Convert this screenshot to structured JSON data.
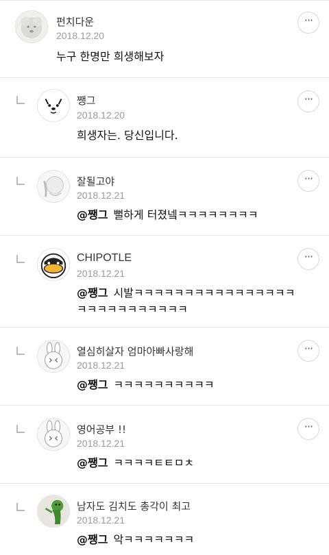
{
  "comments": [
    {
      "name": "펀치다운",
      "date": "2018.12.20",
      "text": "누구 한명만 희생해보자",
      "mention": ""
    },
    {
      "name": "쨍그",
      "date": "2018.12.20",
      "text": "희생자는. 당신입니다.",
      "mention": ""
    },
    {
      "name": "잘될고야",
      "date": "2018.12.21",
      "text": "뻘하게 터졌넼ㅋㅋㅋㅋㅋㅋㅋㅋ",
      "mention": "@쨍그"
    },
    {
      "name": "CHIPOTLE",
      "date": "2018.12.21",
      "text": "시발ㅋㅋㅋㅋㅋㅋㅋㅋㅋㅋㅋㅋㅋㅋㅋㅋㅋㅋㅋㅋㅋㅋㅋㅋㅋㅋㅋ",
      "mention": "@쨍그"
    },
    {
      "name": "열심히살자 엄마아빠사랑해",
      "date": "2018.12.21",
      "text": "ㅋㅋㅋㅋㅋㅋㅋㅋㅋㅋ",
      "mention": "@쨍그"
    },
    {
      "name": "영어공부 !!",
      "date": "2018.12.21",
      "text": "ㅋㅋㅋㅋㅌㅌㅁㅊ",
      "mention": "@쨍그"
    },
    {
      "name": "남자도 김치도 총각이 최고",
      "date": "2018.12.21",
      "text": "악ㅋㅋㅋㅋㅋㅋㅋ",
      "mention": "@쨍그"
    }
  ],
  "more_label": "···",
  "icons": {
    "avatar_icons": [
      "fluffy-dog-avatar-icon",
      "dog-face-avatar-icon",
      "crying-character-avatar-icon",
      "duck-avatar-icon",
      "rabbit-avatar-icon",
      "rabbit-avatar-icon",
      "green-figure-avatar-icon"
    ],
    "more": "more-options-icon",
    "reply": "reply-arrow-icon"
  }
}
